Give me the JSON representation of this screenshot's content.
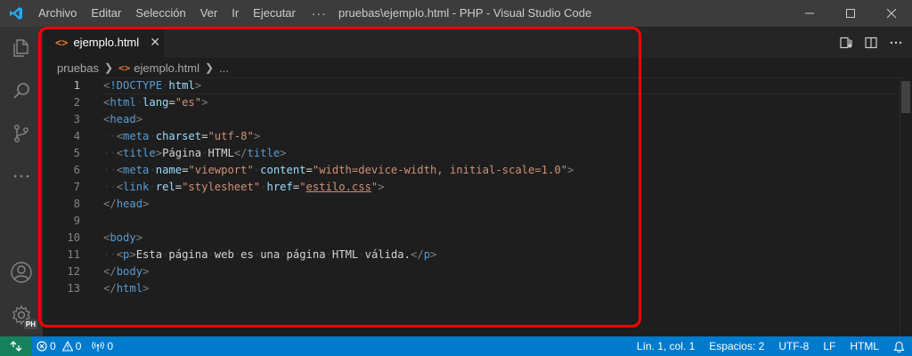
{
  "titlebar": {
    "menu": [
      "Archivo",
      "Editar",
      "Selección",
      "Ver",
      "Ir",
      "Ejecutar"
    ],
    "more": "···",
    "window_title": "pruebas\\ejemplo.html - PHP - Visual Studio Code",
    "logo_icon": "vscode-logo-icon",
    "controls": [
      "minimize-icon",
      "maximize-icon",
      "close-icon"
    ]
  },
  "activity": {
    "items": [
      "explorer-icon",
      "search-icon",
      "source-control-icon",
      "more-icon"
    ],
    "bottom": [
      "account-icon",
      "settings-icon"
    ],
    "profile_badge": "PH"
  },
  "tab": {
    "icon": "<>",
    "label": "ejemplo.html",
    "close": "✕"
  },
  "breadcrumb": {
    "folder": "pruebas",
    "file_icon": "<>",
    "file": "ejemplo.html",
    "more": "..."
  },
  "editor": {
    "line_numbers": [
      "1",
      "2",
      "3",
      "4",
      "5",
      "6",
      "7",
      "8",
      "9",
      "10",
      "11",
      "12",
      "13"
    ],
    "lines": [
      {
        "segments": [
          [
            "p",
            "<"
          ],
          [
            "t",
            "!DOCTYPE"
          ],
          [
            "w",
            "·"
          ],
          [
            "a",
            "html"
          ],
          [
            "p",
            ">"
          ]
        ]
      },
      {
        "segments": [
          [
            "p",
            "<"
          ],
          [
            "t",
            "html"
          ],
          [
            "w",
            "·"
          ],
          [
            "a",
            "lang"
          ],
          [
            "x",
            "="
          ],
          [
            "s",
            "\"es\""
          ],
          [
            "p",
            ">"
          ]
        ]
      },
      {
        "segments": [
          [
            "p",
            "<"
          ],
          [
            "t",
            "head"
          ],
          [
            "p",
            ">"
          ]
        ]
      },
      {
        "segments": [
          [
            "w",
            "··"
          ],
          [
            "p",
            "<"
          ],
          [
            "t",
            "meta"
          ],
          [
            "w",
            "·"
          ],
          [
            "a",
            "charset"
          ],
          [
            "x",
            "="
          ],
          [
            "s",
            "\"utf-8\""
          ],
          [
            "p",
            ">"
          ]
        ]
      },
      {
        "segments": [
          [
            "w",
            "··"
          ],
          [
            "p",
            "<"
          ],
          [
            "t",
            "title"
          ],
          [
            "p",
            ">"
          ],
          [
            "x",
            "Página"
          ],
          [
            "w",
            "·"
          ],
          [
            "x",
            "HTML"
          ],
          [
            "p",
            "</"
          ],
          [
            "t",
            "title"
          ],
          [
            "p",
            ">"
          ]
        ]
      },
      {
        "segments": [
          [
            "w",
            "··"
          ],
          [
            "p",
            "<"
          ],
          [
            "t",
            "meta"
          ],
          [
            "w",
            "·"
          ],
          [
            "a",
            "name"
          ],
          [
            "x",
            "="
          ],
          [
            "s",
            "\"viewport\""
          ],
          [
            "w",
            "·"
          ],
          [
            "a",
            "content"
          ],
          [
            "x",
            "="
          ],
          [
            "s",
            "\"width=device-width, initial-scale=1.0\""
          ],
          [
            "p",
            ">"
          ]
        ]
      },
      {
        "segments": [
          [
            "w",
            "··"
          ],
          [
            "p",
            "<"
          ],
          [
            "t",
            "link"
          ],
          [
            "w",
            "·"
          ],
          [
            "a",
            "rel"
          ],
          [
            "x",
            "="
          ],
          [
            "s",
            "\"stylesheet\""
          ],
          [
            "w",
            "·"
          ],
          [
            "a",
            "href"
          ],
          [
            "x",
            "="
          ],
          [
            "s",
            "\""
          ],
          [
            "u",
            "estilo.css"
          ],
          [
            "s",
            "\""
          ],
          [
            "p",
            ">"
          ]
        ]
      },
      {
        "segments": [
          [
            "p",
            "</"
          ],
          [
            "t",
            "head"
          ],
          [
            "p",
            ">"
          ]
        ]
      },
      {
        "segments": []
      },
      {
        "segments": [
          [
            "p",
            "<"
          ],
          [
            "t",
            "body"
          ],
          [
            "p",
            ">"
          ]
        ]
      },
      {
        "segments": [
          [
            "w",
            "··"
          ],
          [
            "p",
            "<"
          ],
          [
            "t",
            "p"
          ],
          [
            "p",
            ">"
          ],
          [
            "x",
            "Esta"
          ],
          [
            "w",
            "·"
          ],
          [
            "x",
            "página"
          ],
          [
            "w",
            "·"
          ],
          [
            "x",
            "web"
          ],
          [
            "w",
            "·"
          ],
          [
            "x",
            "es"
          ],
          [
            "w",
            "·"
          ],
          [
            "x",
            "una"
          ],
          [
            "w",
            "·"
          ],
          [
            "x",
            "página"
          ],
          [
            "w",
            "·"
          ],
          [
            "x",
            "HTML"
          ],
          [
            "w",
            "·"
          ],
          [
            "x",
            "válida."
          ],
          [
            "p",
            "</"
          ],
          [
            "t",
            "p"
          ],
          [
            "p",
            ">"
          ]
        ]
      },
      {
        "segments": [
          [
            "p",
            "</"
          ],
          [
            "t",
            "body"
          ],
          [
            "p",
            ">"
          ]
        ]
      },
      {
        "segments": [
          [
            "p",
            "</"
          ],
          [
            "t",
            "html"
          ],
          [
            "p",
            ">"
          ]
        ]
      }
    ]
  },
  "statusbar": {
    "remote_icon": "remote-icon",
    "errors": "0",
    "warnings": "0",
    "ports": "0",
    "position": "Lín. 1, col. 1",
    "spaces": "Espacios: 2",
    "encoding": "UTF-8",
    "eol": "LF",
    "language": "HTML",
    "notifications_icon": "bell-icon"
  },
  "colors": {
    "accent": "#007acc",
    "remote": "#16825d",
    "highlight": "#ff0000",
    "tag": "#569cd6",
    "attribute": "#9cdcfe",
    "string": "#ce9178"
  }
}
